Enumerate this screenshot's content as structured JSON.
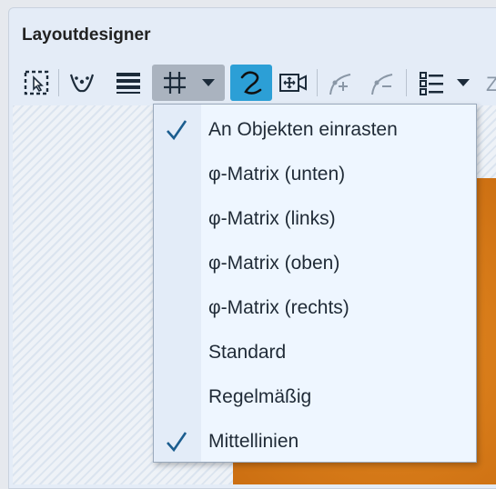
{
  "panel": {
    "title": "Layoutdesigner"
  },
  "toolbar": {
    "buttons": [
      {
        "name": "select-tool",
        "icon": "select-frame-icon"
      },
      {
        "name": "bezier-tool",
        "icon": "bezier-nodes-icon"
      },
      {
        "name": "lines-tool",
        "icon": "horizontal-lines-icon"
      },
      {
        "name": "grid-snap",
        "icon": "grid-hash-icon",
        "active": true
      },
      {
        "name": "curve-tool",
        "icon": "curve-s-icon",
        "highlighted": true
      },
      {
        "name": "video-frame",
        "icon": "video-move-icon"
      },
      {
        "name": "add-curve-point",
        "icon": "curve-add-icon"
      },
      {
        "name": "remove-curve-point",
        "icon": "curve-remove-icon"
      },
      {
        "name": "list-view",
        "icon": "list-icon"
      }
    ],
    "overflow_label": "Z"
  },
  "menu": {
    "items": [
      {
        "label": "An Objekten einrasten",
        "checked": true
      },
      {
        "label": "φ-Matrix (unten)",
        "checked": false
      },
      {
        "label": "φ-Matrix (links)",
        "checked": false
      },
      {
        "label": "φ-Matrix (oben)",
        "checked": false
      },
      {
        "label": "φ-Matrix (rechts)",
        "checked": false
      },
      {
        "label": "Standard",
        "checked": false
      },
      {
        "label": "Regelmäßig",
        "checked": false
      },
      {
        "label": "Mittellinien",
        "checked": true
      }
    ]
  },
  "colors": {
    "accent": "#2c9fd6",
    "check": "#1b5d8f",
    "photo": "#d97d1a"
  }
}
